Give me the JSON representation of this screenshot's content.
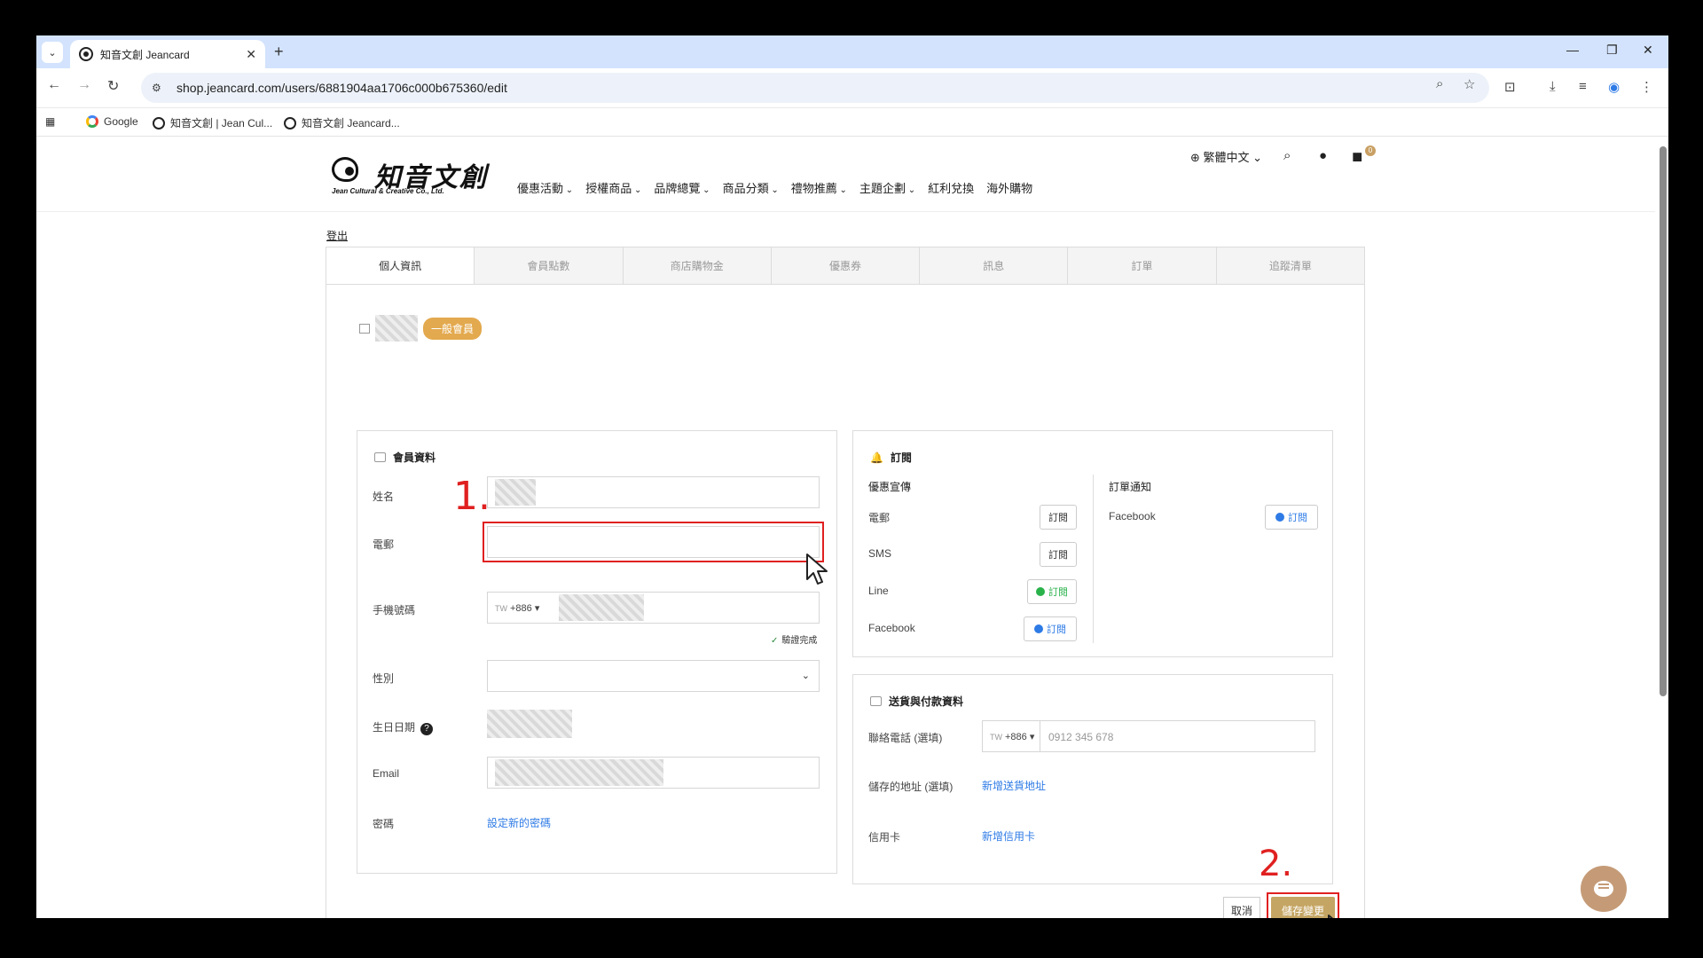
{
  "browser": {
    "tab_title": "知音文創 Jeancard",
    "url": "shop.jeancard.com/users/6881904aa1706c000b675360/edit",
    "bookmarks": [
      "Google",
      "知音文創 | Jean Cul...",
      "知音文創 Jeancard..."
    ]
  },
  "header": {
    "logo_cn": "知音文創",
    "logo_en": "Jean Cultural & Creative Co., Ltd.",
    "nav": [
      "優惠活動",
      "授權商品",
      "品牌總覽",
      "商品分類",
      "禮物推薦",
      "主題企劃",
      "紅利兌換",
      "海外購物"
    ],
    "language": "繁體中文",
    "cart_count": "0"
  },
  "account": {
    "logout": "登出",
    "tabs": [
      "個人資訊",
      "會員點數",
      "商店購物金",
      "優惠券",
      "訊息",
      "訂單",
      "追蹤清單"
    ],
    "member_badge": "一般會員"
  },
  "member_info": {
    "title": "會員資料",
    "name_label": "姓名",
    "email_label": "電郵",
    "phone_label": "手機號碼",
    "phone_country": "TW",
    "phone_code": "+886",
    "verified": "驗證完成",
    "gender_label": "性別",
    "birthday_label": "生日日期",
    "email2_label": "Email",
    "password_label": "密碼",
    "password_link": "設定新的密碼"
  },
  "subscriptions": {
    "title": "訂閱",
    "promo_title": "優惠宣傳",
    "order_title": "訂單通知",
    "rows": [
      {
        "label": "電郵",
        "button": "訂閱"
      },
      {
        "label": "SMS",
        "button": "訂閱"
      },
      {
        "label": "Line",
        "button": "訂閱"
      },
      {
        "label": "Facebook",
        "button": "訂閱"
      }
    ],
    "order_facebook_label": "Facebook",
    "order_facebook_button": "訂閱"
  },
  "delivery": {
    "title": "送貨與付款資料",
    "phone_label": "聯絡電話 (選填)",
    "phone_country": "TW",
    "phone_code": "+886",
    "phone_placeholder": "0912 345 678",
    "address_label": "儲存的地址 (選填)",
    "address_link": "新增送貨地址",
    "card_label": "信用卡",
    "card_link": "新增信用卡"
  },
  "actions": {
    "cancel": "取消",
    "save": "儲存變更"
  },
  "annotations": {
    "step1": "1.",
    "step2": "2."
  },
  "colors": {
    "badge": "#e3a94e",
    "save": "#c5a563",
    "link": "#2e7be6",
    "annotation": "#e02020"
  }
}
